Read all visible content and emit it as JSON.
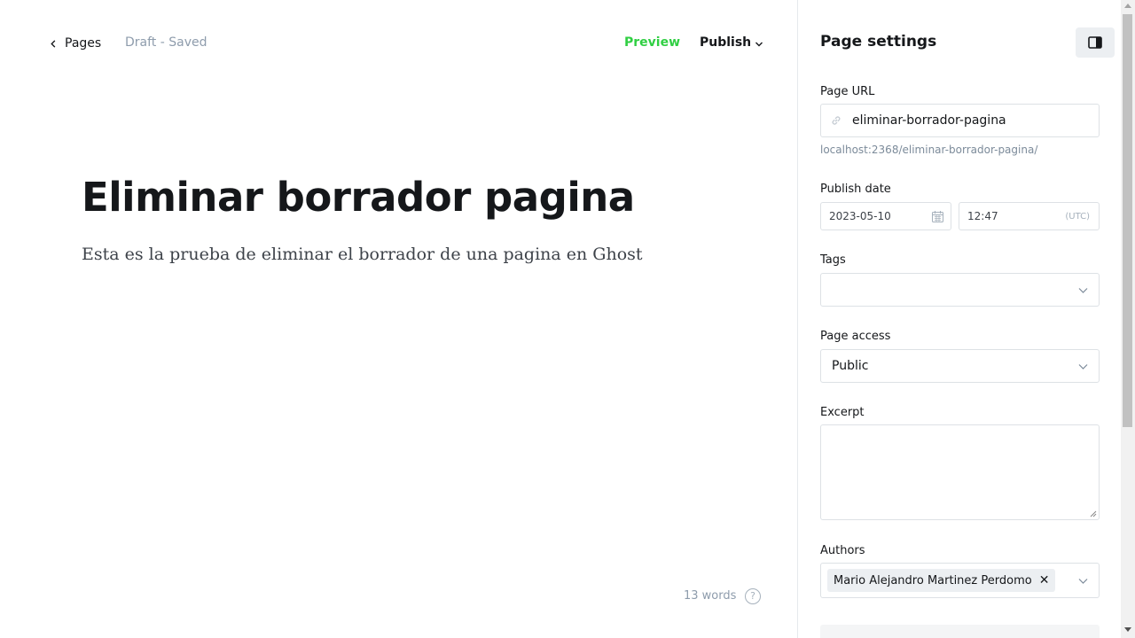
{
  "editor": {
    "back_label": "Pages",
    "status": "Draft - Saved",
    "preview_label": "Preview",
    "publish_label": "Publish",
    "title": "Eliminar borrador pagina",
    "body": "Esta es la prueba de eliminar el borrador de una pagina en Ghost",
    "word_count": "13 words",
    "help_symbol": "?"
  },
  "settings": {
    "title": "Page settings",
    "url": {
      "label": "Page URL",
      "value": "eliminar-borrador-pagina",
      "hint": "localhost:2368/eliminar-borrador-pagina/"
    },
    "publish_date": {
      "label": "Publish date",
      "date": "2023-05-10",
      "time": "12:47",
      "timezone": "(UTC)"
    },
    "tags": {
      "label": "Tags",
      "value": ""
    },
    "access": {
      "label": "Page access",
      "value": "Public"
    },
    "excerpt": {
      "label": "Excerpt",
      "value": ""
    },
    "authors": {
      "label": "Authors",
      "items": [
        "Mario Alejandro Martinez Perdomo"
      ],
      "remove_symbol": "✕"
    }
  },
  "colors": {
    "accent_green": "#30cf43",
    "text_dark": "#15171a",
    "muted": "#8e9cac",
    "border": "#dde1e5",
    "chip_bg": "#eceff2"
  },
  "icons": [
    "chevron-left-icon",
    "chevron-down-icon",
    "help-icon",
    "sidebar-toggle-icon",
    "link-icon",
    "calendar-icon"
  ]
}
